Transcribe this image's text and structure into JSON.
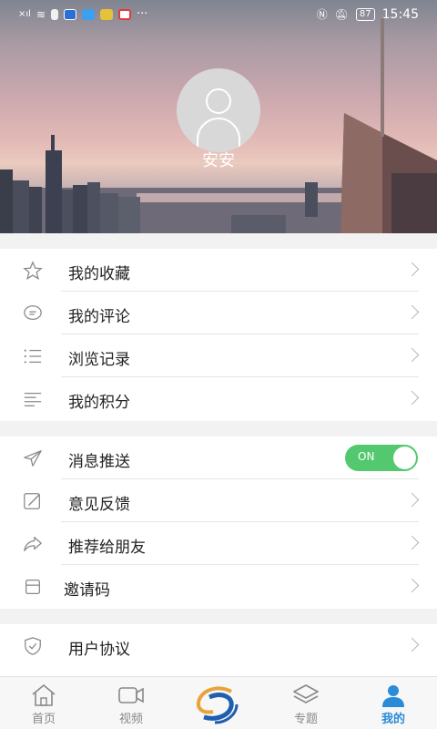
{
  "status_bar": {
    "time": "15:45",
    "battery": "87",
    "notifications_more": "···"
  },
  "profile": {
    "username": "安安"
  },
  "section1": [
    {
      "label": "我的收藏",
      "icon": "star-icon"
    },
    {
      "label": "我的评论",
      "icon": "comment-icon"
    },
    {
      "label": "浏览记录",
      "icon": "list-icon"
    },
    {
      "label": "我的积分",
      "icon": "lines-icon"
    }
  ],
  "section2": {
    "push": {
      "label": "消息推送",
      "icon": "send-icon",
      "toggle_label": "ON",
      "toggle_on": true
    },
    "items": [
      {
        "label": "意见反馈",
        "icon": "edit-icon"
      },
      {
        "label": "推荐给朋友",
        "icon": "share-icon"
      },
      {
        "label": "邀请码",
        "icon": "box-icon"
      }
    ]
  },
  "section3": [
    {
      "label": "用户协议",
      "icon": "shield-icon"
    }
  ],
  "tabbar": [
    {
      "label": "首页",
      "icon": "home-icon",
      "active": false
    },
    {
      "label": "视频",
      "icon": "video-icon",
      "active": false
    },
    {
      "label": "",
      "icon": "logo-icon",
      "active": false
    },
    {
      "label": "专题",
      "icon": "layers-icon",
      "active": false
    },
    {
      "label": "我的",
      "icon": "user-icon",
      "active": true
    }
  ],
  "colors": {
    "accent": "#2b8bd8",
    "toggle_on": "#53c86f"
  }
}
